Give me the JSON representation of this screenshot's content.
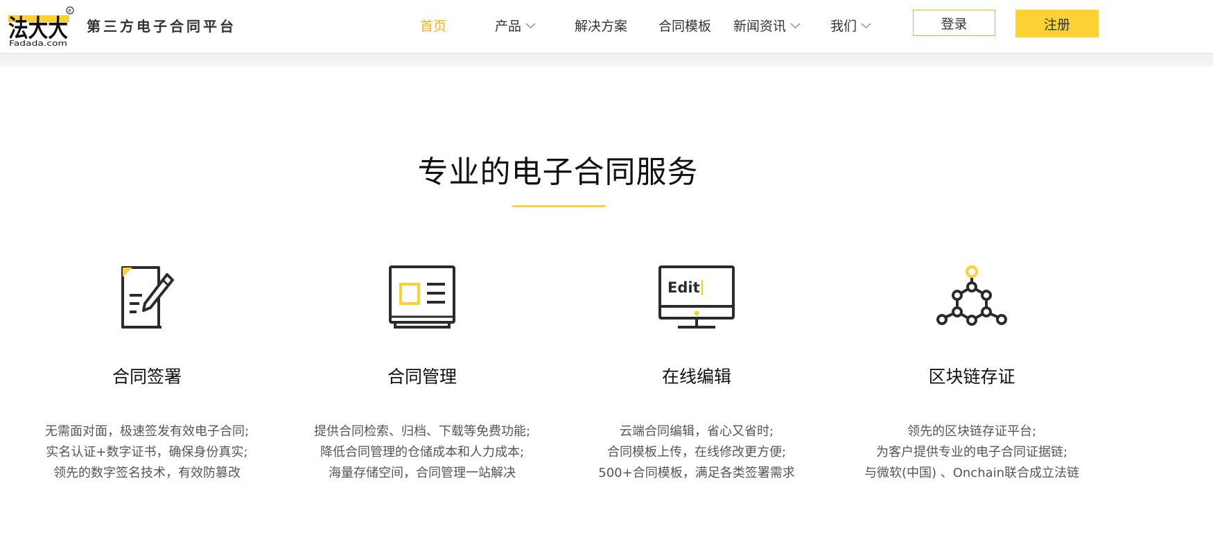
{
  "header": {
    "logo_text": "法大大",
    "logo_domain": "Fadada.com",
    "tagline": "第三方电子合同平台",
    "nav": [
      {
        "label": "首页",
        "active": true
      },
      {
        "label": "产品",
        "dropdown": true
      },
      {
        "label": "解决方案"
      },
      {
        "label": "合同模板"
      },
      {
        "label": "新闻资讯",
        "dropdown": true
      },
      {
        "label": "我们",
        "dropdown": true
      }
    ],
    "login_label": "登录",
    "register_label": "注册"
  },
  "section": {
    "title": "专业的电子合同服务"
  },
  "features": [
    {
      "icon": "contract-sign-icon",
      "title": "合同签署",
      "lines": [
        "无需面对面，极速签发有效电子合同;",
        "实名认证+数字证书，确保身份真实;",
        "领先的数字签名技术，有效防篡改"
      ]
    },
    {
      "icon": "contract-manage-icon",
      "title": "合同管理",
      "lines": [
        "提供合同检索、归档、下载等免费功能;",
        "降低合同管理的仓储成本和人力成本;",
        "海量存储空间，合同管理一站解决"
      ]
    },
    {
      "icon": "online-edit-icon",
      "icon_text": "Edit",
      "title": "在线编辑",
      "lines": [
        "云端合同编辑，省心又省时;",
        "合同模板上传，在线修改更方便;",
        "500+合同模板，满足各类签署需求"
      ]
    },
    {
      "icon": "blockchain-icon",
      "title": "区块链存证",
      "lines": [
        "领先的区块链存证平台;",
        "为客户提供专业的电子合同证据链;",
        "与微软(中国) 、Onchain联合成立法链"
      ]
    }
  ],
  "colors": {
    "accent": "#fcd134",
    "accent_text": "#f2b21a",
    "text_dark": "#111111",
    "text_body": "#555555"
  }
}
